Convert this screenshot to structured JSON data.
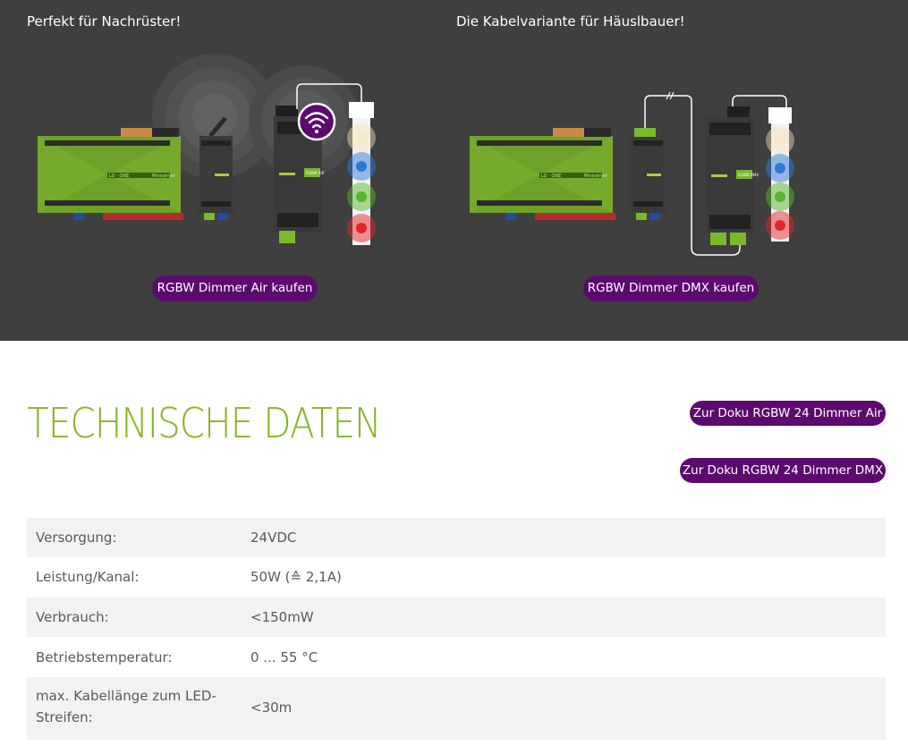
{
  "hero": {
    "left": {
      "title": "Perfekt für Nachrüster!",
      "button": "RGBW Dimmer Air kaufen",
      "illustration": {
        "miniserver_label": "LD · ONE",
        "miniserver_brand": "Miniserver",
        "dimmer_label": "RGBW AIR"
      }
    },
    "right": {
      "title": "Die Kabelvariante für Häuslbauer!",
      "button": "RGBW Dimmer DMX kaufen",
      "illustration": {
        "miniserver_label": "LD · ONE",
        "miniserver_brand": "Miniserver",
        "dimmer_label": "RGBW DMX"
      }
    }
  },
  "tech": {
    "title": "TECHNISCHE DATEN",
    "doc_buttons": [
      "Zur Doku RGBW 24 Dimmer Air",
      "Zur Doku RGBW 24 Dimmer DMX"
    ]
  },
  "specs": [
    {
      "label": "Versorgung:",
      "value": "24VDC"
    },
    {
      "label": "Leistung/Kanal:",
      "value": "50W (≙ 2,1A)"
    },
    {
      "label": "Verbrauch:",
      "value": "<150mW"
    },
    {
      "label": "Betriebstemperatur:",
      "value": "0 ... 55 °C"
    },
    {
      "label": "max. Kabellänge zum LED-Streifen:",
      "value": "<30m"
    }
  ],
  "colors": {
    "hero_bg": "#3f3f3f",
    "accent_purple": "#5c0a6e",
    "heading_green": "#84b522",
    "device_green": "#6ea12a"
  }
}
